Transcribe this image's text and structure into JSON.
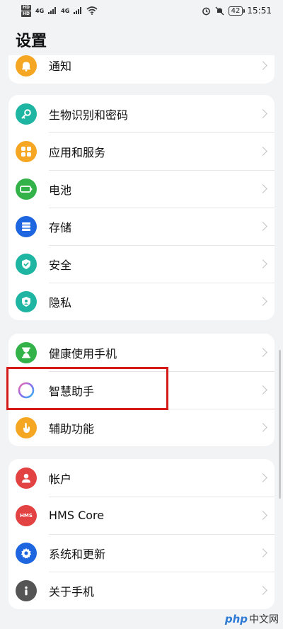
{
  "status_bar": {
    "hd_label": "HD",
    "signal_4g_1": "4G",
    "signal_4g_2": "4G",
    "battery": "42",
    "time": "15:51"
  },
  "page": {
    "title": "设置"
  },
  "groups": [
    {
      "items": [
        {
          "label": "通知",
          "icon": "bell-icon",
          "color": "#f5a623"
        }
      ]
    },
    {
      "items": [
        {
          "label": "生物识别和密码",
          "icon": "key-icon",
          "color": "#1fb5a3"
        },
        {
          "label": "应用和服务",
          "icon": "apps-grid-icon",
          "color": "#f5a623"
        },
        {
          "label": "电池",
          "icon": "battery-icon",
          "color": "#34b24a"
        },
        {
          "label": "存储",
          "icon": "storage-icon",
          "color": "#1e66e0"
        },
        {
          "label": "安全",
          "icon": "shield-check-icon",
          "color": "#1fb5a3"
        },
        {
          "label": "隐私",
          "icon": "privacy-shield-icon",
          "color": "#1fb5a3"
        }
      ]
    },
    {
      "items": [
        {
          "label": "健康使用手机",
          "icon": "hourglass-icon",
          "color": "#34b24a"
        },
        {
          "label": "智慧助手",
          "icon": "assistant-ring-icon",
          "color": "#ffffff"
        },
        {
          "label": "辅助功能",
          "icon": "hand-icon",
          "color": "#f5a623"
        }
      ]
    },
    {
      "items": [
        {
          "label": "帐户",
          "icon": "user-icon",
          "color": "#e34242"
        },
        {
          "label": "HMS Core",
          "icon": "hms-icon",
          "color": "#e34242",
          "icon_text": "HMS"
        },
        {
          "label": "系统和更新",
          "icon": "gear-icon",
          "color": "#1e66e0"
        },
        {
          "label": "关于手机",
          "icon": "info-icon",
          "color": "#555555"
        }
      ]
    }
  ],
  "watermark": {
    "logo": "php",
    "text": "中文网"
  }
}
